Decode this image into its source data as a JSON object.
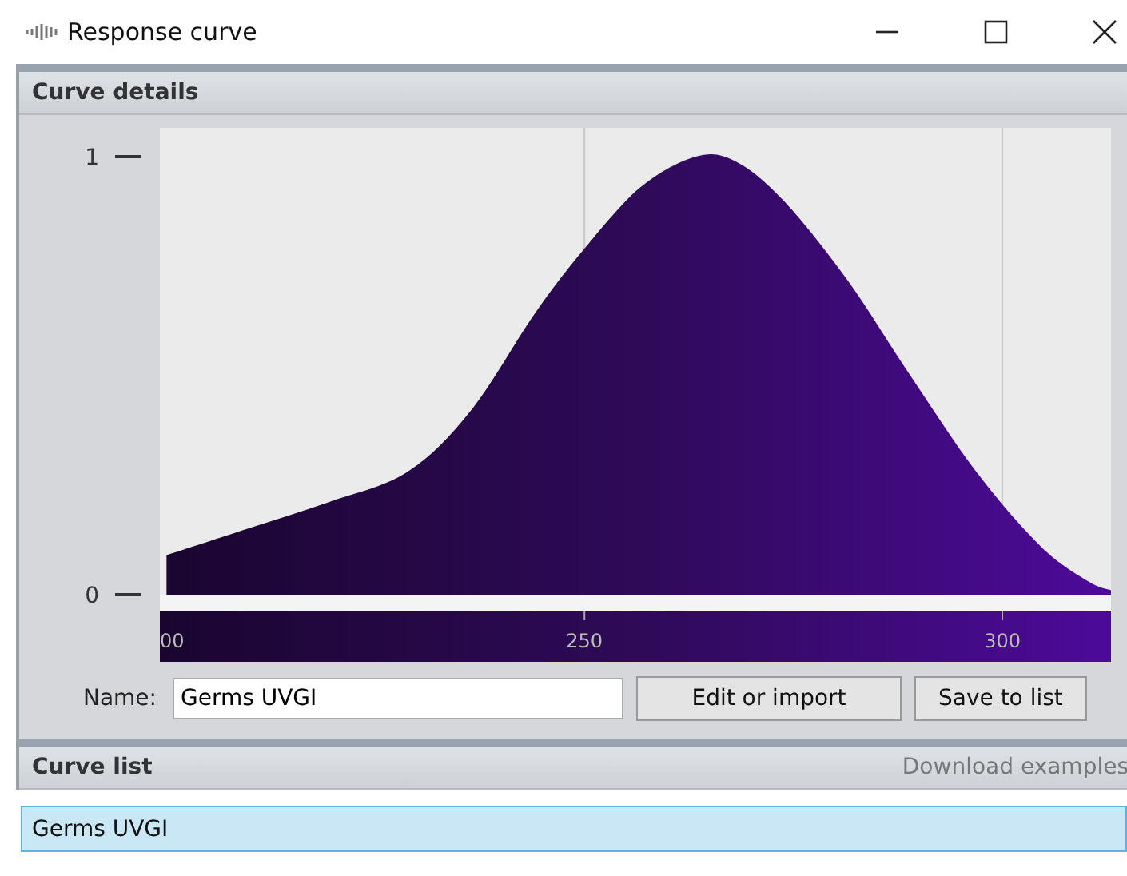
{
  "window": {
    "title": "Response curve"
  },
  "curve_details": {
    "title": "Curve details",
    "chart_data": {
      "type": "area",
      "x": [
        200,
        209.6,
        219.2,
        228.8,
        236.4,
        244,
        250,
        256.7,
        263.3,
        268,
        273.8,
        281.4,
        289,
        296.9,
        304.6,
        310.3,
        313
      ],
      "values": [
        0.09,
        0.15,
        0.21,
        0.28,
        0.42,
        0.64,
        0.79,
        0.93,
        1.0,
        0.99,
        0.9,
        0.72,
        0.5,
        0.28,
        0.11,
        0.03,
        0.01
      ],
      "xlim": [
        199.2,
        313
      ],
      "ylim": [
        0,
        1
      ],
      "xticks": [
        250,
        300
      ],
      "yticks": [
        0,
        1
      ],
      "grid": true
    },
    "cut_tick_label": "00",
    "name_label": "Name:",
    "name_value": "Germs UVGI",
    "buttons": [
      {
        "label": "Edit or import"
      },
      {
        "label": "Save to list"
      }
    ]
  },
  "curve_list": {
    "title": "Curve list",
    "link": "Download examples",
    "items": [
      {
        "label": "Germs UVGI",
        "selected": true
      }
    ]
  }
}
